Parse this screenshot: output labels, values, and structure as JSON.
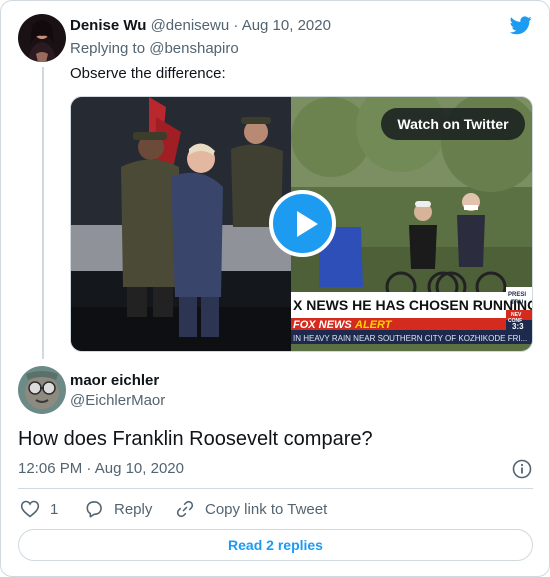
{
  "reply_tweet": {
    "author_name": "Denise Wu",
    "author_handle": "@denisewu",
    "separator": "·",
    "date": "Aug 10, 2020",
    "replying_label": "Replying to",
    "replying_to": "@benshapiro",
    "text": "Observe the difference:",
    "media": {
      "watch_label": "Watch on Twitter",
      "ticker_headline": "X NEWS HE HAS CHOSEN RUNNING MATE",
      "ticker_alert_brand": "FOX NEWS",
      "ticker_alert_word": "ALERT",
      "ticker_crawl": "IN HEAVY RAIN NEAR SOUTHERN CITY OF KOZHIKODE FRI...",
      "side_badge_top": "PRESI",
      "side_badge_mid": "TRU",
      "side_badge_red": "NEV",
      "side_badge_red2": "CONF",
      "side_badge_time": "3:3"
    }
  },
  "main_tweet": {
    "author_name": "maor eichler",
    "author_handle": "@EichlerMaor",
    "text": "How does Franklin Roosevelt compare?",
    "time": "12:06 PM",
    "separator": "·",
    "date": "Aug 10, 2020"
  },
  "actions": {
    "like_count": "1",
    "reply_label": "Reply",
    "copy_label": "Copy link to Tweet"
  },
  "read_replies_label": "Read 2 replies",
  "icons": {
    "brand": "twitter-bird-icon",
    "play": "play-icon",
    "info": "info-icon",
    "like": "heart-icon",
    "reply": "reply-icon",
    "copy": "link-icon"
  },
  "colors": {
    "accent": "#1d9bf0",
    "muted": "#536471",
    "border": "#cfd9de",
    "fox_red": "#d52b1e"
  }
}
